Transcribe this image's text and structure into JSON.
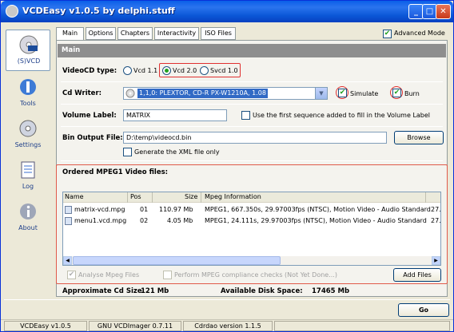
{
  "window": {
    "title": "VCDEasy v1.0.5 by delphi.stuff"
  },
  "nav": [
    {
      "label": "(S)VCD",
      "icon": "cd-icon"
    },
    {
      "label": "Tools",
      "icon": "tools-icon"
    },
    {
      "label": "Settings",
      "icon": "settings-icon"
    },
    {
      "label": "Log",
      "icon": "log-icon"
    },
    {
      "label": "About",
      "icon": "info-icon"
    }
  ],
  "tabs": [
    "Main",
    "Options",
    "Chapters",
    "Interactivity",
    "ISO Files"
  ],
  "advanced_mode": {
    "label": "Advanced Mode",
    "checked": true
  },
  "section_title": "Main",
  "videocd_type": {
    "label": "VideoCD type:",
    "options": [
      "Vcd 1.1",
      "Vcd 2.0",
      "Svcd 1.0"
    ],
    "selected": "Vcd 2.0"
  },
  "cd_writer": {
    "label": "Cd Writer:",
    "value": "1,1,0: PLEXTOR, CD-R PX-W1210A, 1.08",
    "simulate": "Simulate",
    "burn": "Burn"
  },
  "volume_label": {
    "label": "Volume Label:",
    "value": "MATRIX",
    "use_first_label": "Use the first sequence added to fill in the Volume Label"
  },
  "bin_output": {
    "label": "Bin Output File:",
    "value": "D:\\temp\\videocd.bin",
    "browse": "Browse",
    "xml_label": "Generate the XML file only"
  },
  "files": {
    "title": "Ordered MPEG1 Video files:",
    "columns": [
      "Name",
      "Pos",
      "Size",
      "Mpeg Information"
    ],
    "rows": [
      {
        "name": "matrix-vcd.mpg",
        "pos": "01",
        "size": "110.97 Mb",
        "info": "MPEG1, 667.350s, 29.97003fps (NTSC), Motion Video - Audio Standard",
        "extra": "27."
      },
      {
        "name": "menu1.vcd.mpg",
        "pos": "02",
        "size": "4.05 Mb",
        "info": "MPEG1, 24.111s, 29.97003fps (NTSC), Motion Video - Audio Standard",
        "extra": "27."
      }
    ],
    "analyse": "Analyse Mpeg Files",
    "compliance": "Perform MPEG compliance checks (Not Yet Done...)",
    "add_files": "Add Files"
  },
  "summary": {
    "cd_size_label": "Approximate Cd Size:",
    "cd_size_value": "121 Mb",
    "disk_space_label": "Available Disk Space:",
    "disk_space_value": "17465 Mb"
  },
  "go_button": "Go",
  "statusbar": [
    "VCDEasy v1.0.5",
    "GNU VCDImager 0.7.11",
    "Cdrdao version 1.1.5"
  ]
}
